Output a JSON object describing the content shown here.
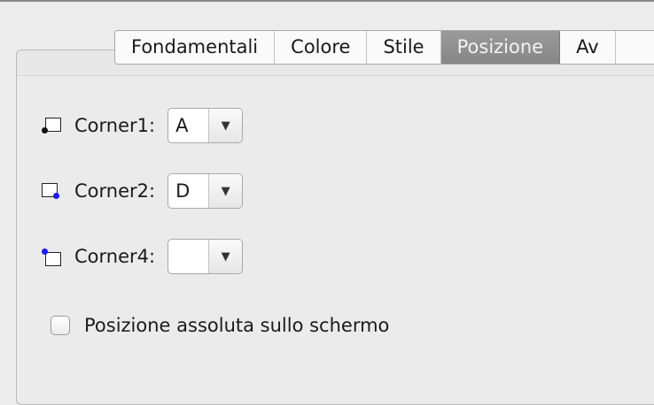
{
  "tabs": [
    "Fondamentali",
    "Colore",
    "Stile",
    "Posizione",
    "Av"
  ],
  "active_tab": "Posizione",
  "corners": [
    {
      "label": "Corner1:",
      "value": "A",
      "icon": "corner-bottom-left-icon",
      "dot_color": "#111111"
    },
    {
      "label": "Corner2:",
      "value": "D",
      "icon": "corner-bottom-right-icon",
      "dot_color": "#1a1aff"
    },
    {
      "label": "Corner4:",
      "value": "",
      "icon": "corner-top-left-icon",
      "dot_color": "#1a1aff"
    }
  ],
  "dropdown_arrow": "▼",
  "absolute_position": {
    "label": "Posizione assoluta sullo schermo",
    "checked": false
  }
}
